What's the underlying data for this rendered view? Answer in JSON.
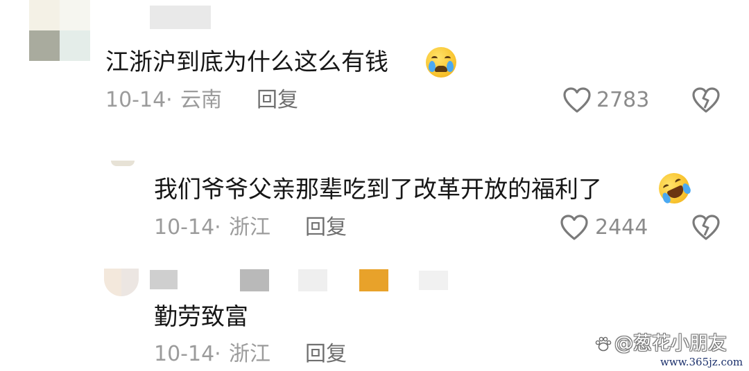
{
  "comments": [
    {
      "text": "江浙沪到底为什么这么有钱",
      "emoji": "crying-face-emoji",
      "date": "10-14·",
      "location": "云南",
      "reply_label": "回复",
      "likes": "2783"
    },
    {
      "text": "我们爷爷父亲那辈吃到了改革开放的福利了",
      "emoji": "rolling-laughing-emoji",
      "date": "10-14·",
      "location": "浙江",
      "reply_label": "回复",
      "likes": "2444"
    },
    {
      "text": "勤劳致富",
      "date": "10-14·",
      "location": "浙江",
      "reply_label": "回复"
    }
  ],
  "watermark": {
    "handle": "@葱花小朋友",
    "site": "www.365jz.com"
  },
  "colors": {
    "text": "#161616",
    "meta": "#9b9b9b",
    "icon": "#7a7a7a"
  }
}
